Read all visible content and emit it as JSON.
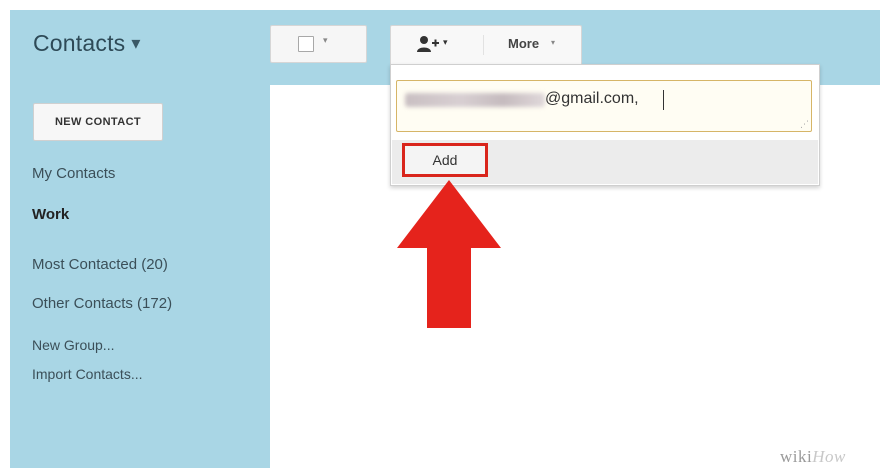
{
  "header": {
    "app_title": "Contacts",
    "title_caret": "▾"
  },
  "sidebar": {
    "new_contact_label": "NEW CONTACT",
    "items": [
      {
        "label": "My Contacts"
      },
      {
        "label": "Work"
      },
      {
        "label": "Most Contacted (20)"
      },
      {
        "label": "Other Contacts (172)"
      },
      {
        "label": "New Group..."
      },
      {
        "label": "Import Contacts..."
      }
    ]
  },
  "toolbar": {
    "select_caret": "▾",
    "group_caret": "▾",
    "more_label": "More",
    "more_caret": "▾"
  },
  "popup": {
    "email_value_visible": "@gmail.com,",
    "add_label": "Add"
  },
  "annotation": {
    "arrow_color": "#e5231c",
    "highlight_color": "#d9251c"
  },
  "watermark": {
    "text_main": "wiki",
    "text_light": "How"
  },
  "colors": {
    "sidebar_bg": "#a9d6e5",
    "input_border": "#d6b567"
  }
}
